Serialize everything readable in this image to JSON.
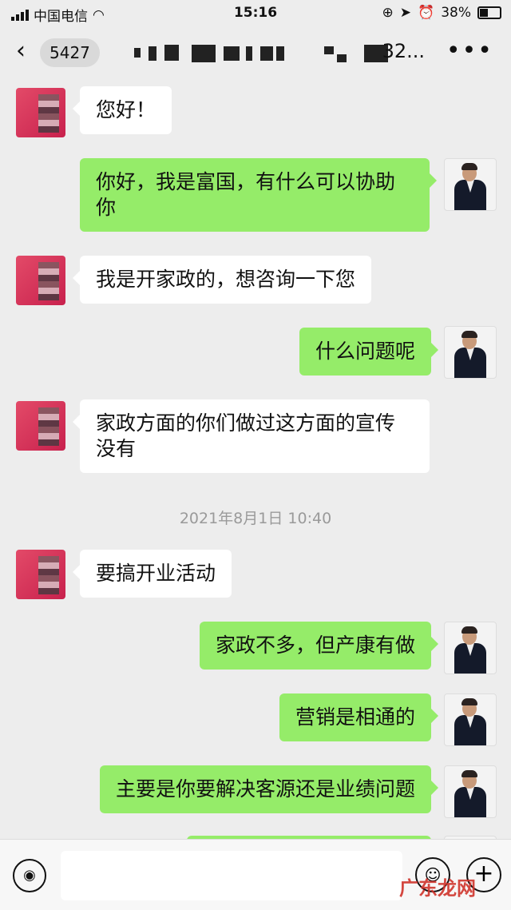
{
  "status": {
    "carrier": "中国电信",
    "time": "15:16",
    "battery": "38%"
  },
  "nav": {
    "back": "‹",
    "unread": "5427",
    "title_tail": "32...",
    "more": "•••"
  },
  "messages": [
    {
      "side": "left",
      "text": "您好！"
    },
    {
      "side": "right",
      "text": "你好，我是富国，有什么可以协助你"
    },
    {
      "side": "left",
      "text": "我是开家政的，想咨询一下您"
    },
    {
      "side": "right",
      "text": "什么问题呢"
    },
    {
      "side": "left",
      "text": "家政方面的你们做过这方面的宣传没有"
    },
    {
      "side": "left",
      "text": "要搞开业活动"
    },
    {
      "side": "right",
      "text": "家政不多，但产康有做"
    },
    {
      "side": "right",
      "text": "营销是相通的"
    },
    {
      "side": "right",
      "text": "主要是你要解决客源还是业绩问题"
    }
  ],
  "timestamp": "2021年8月1日 10:40",
  "input": {
    "placeholder": ""
  },
  "watermark": "广东龙网"
}
